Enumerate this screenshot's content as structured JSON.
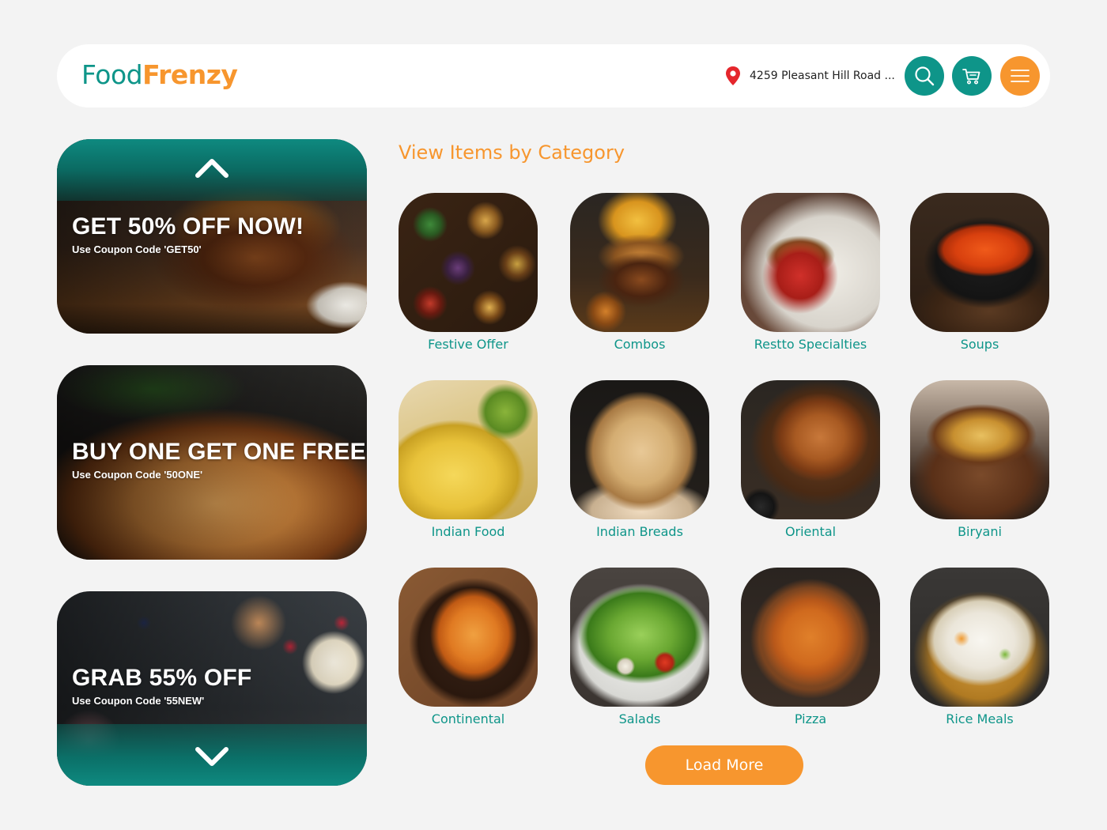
{
  "header": {
    "logo_part1": "Food",
    "logo_part2": "Frenzy",
    "location": "4259 Pleasant Hill Road ...",
    "search_icon": "search-icon",
    "cart_icon": "cart-icon",
    "menu_icon": "menu-icon"
  },
  "promos": [
    {
      "title": "GET 50% OFF NOW!",
      "subtitle": "Use Coupon Code 'GET50'"
    },
    {
      "title": "BUY ONE GET ONE FREE",
      "subtitle": "Use Coupon Code '50ONE'"
    },
    {
      "title": "GRAB 55% OFF",
      "subtitle": "Use Coupon Code '55NEW'"
    }
  ],
  "section_title": "View Items by Category",
  "categories": [
    {
      "label": "Festive Offer"
    },
    {
      "label": "Combos"
    },
    {
      "label": "Restto Specialties"
    },
    {
      "label": "Soups"
    },
    {
      "label": "Indian Food"
    },
    {
      "label": "Indian Breads"
    },
    {
      "label": "Oriental"
    },
    {
      "label": "Biryani"
    },
    {
      "label": "Continental"
    },
    {
      "label": "Salads"
    },
    {
      "label": "Pizza"
    },
    {
      "label": "Rice Meals"
    }
  ],
  "load_more": "Load More",
  "colors": {
    "teal": "#0e9589",
    "orange": "#f7962e",
    "background": "#f3f3f3",
    "pin_red": "#e5262c"
  }
}
